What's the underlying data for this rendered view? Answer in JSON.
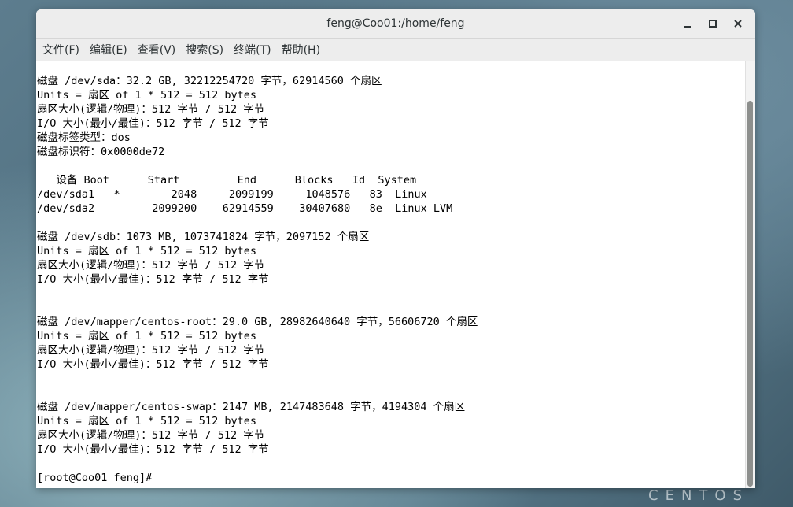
{
  "window": {
    "title": "feng@Coo01:/home/feng"
  },
  "menubar": {
    "items": [
      "文件(F)",
      "编辑(E)",
      "查看(V)",
      "搜索(S)",
      "终端(T)",
      "帮助(H)"
    ]
  },
  "terminal": {
    "lines": [
      "磁盘 /dev/sda：32.2 GB, 32212254720 字节，62914560 个扇区",
      "Units = 扇区 of 1 * 512 = 512 bytes",
      "扇区大小(逻辑/物理)：512 字节 / 512 字节",
      "I/O 大小(最小/最佳)：512 字节 / 512 字节",
      "磁盘标签类型：dos",
      "磁盘标识符：0x0000de72",
      "",
      "   设备 Boot      Start         End      Blocks   Id  System",
      "/dev/sda1   *        2048     2099199     1048576   83  Linux",
      "/dev/sda2         2099200    62914559    30407680   8e  Linux LVM",
      "",
      "磁盘 /dev/sdb：1073 MB, 1073741824 字节，2097152 个扇区",
      "Units = 扇区 of 1 * 512 = 512 bytes",
      "扇区大小(逻辑/物理)：512 字节 / 512 字节",
      "I/O 大小(最小/最佳)：512 字节 / 512 字节",
      "",
      "",
      "磁盘 /dev/mapper/centos-root：29.0 GB, 28982640640 字节，56606720 个扇区",
      "Units = 扇区 of 1 * 512 = 512 bytes",
      "扇区大小(逻辑/物理)：512 字节 / 512 字节",
      "I/O 大小(最小/最佳)：512 字节 / 512 字节",
      "",
      "",
      "磁盘 /dev/mapper/centos-swap：2147 MB, 2147483648 字节，4194304 个扇区",
      "Units = 扇区 of 1 * 512 = 512 bytes",
      "扇区大小(逻辑/物理)：512 字节 / 512 字节",
      "I/O 大小(最小/最佳)：512 字节 / 512 字节",
      "",
      "[root@Coo01 feng]# "
    ]
  },
  "desktop": {
    "brand": "CENTOS"
  },
  "icons": {
    "minimize": "minimize-icon",
    "maximize": "maximize-icon",
    "close": "close-icon"
  }
}
